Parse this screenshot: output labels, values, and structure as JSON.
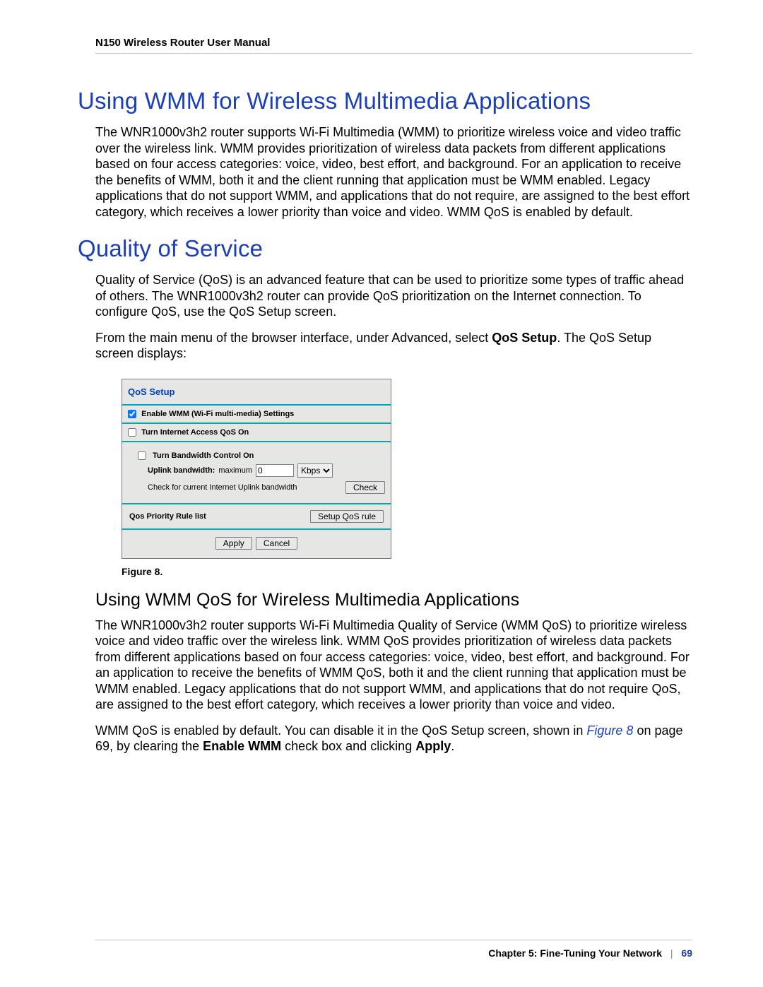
{
  "doc_header": "N150 Wireless Router User Manual",
  "section_wmm_title": "Using WMM for Wireless Multimedia Applications",
  "section_wmm_body": "The WNR1000v3h2 router supports Wi-Fi Multimedia (WMM) to prioritize wireless voice and video traffic over the wireless link. WMM provides prioritization of wireless data packets from different applications based on four access categories: voice, video, best effort, and background. For an application to receive the benefits of WMM, both it and the client running that application must be WMM enabled. Legacy applications that do not support WMM, and applications that do not require, are assigned to the best effort category, which receives a lower priority than voice and video. WMM QoS is enabled by default.",
  "section_qos_title": "Quality of Service",
  "section_qos_body1": "Quality of Service (QoS) is an advanced feature that can be used to prioritize some types of traffic ahead of others. The WNR1000v3h2 router can provide QoS prioritization on the Internet connection. To configure QoS, use the QoS Setup screen.",
  "section_qos_body2_pre": "From the main menu of the browser interface, under Advanced, select ",
  "section_qos_body2_bold": "QoS Setup",
  "section_qos_body2_post": ". The QoS Setup screen displays:",
  "qos_panel": {
    "title": "QoS Setup",
    "enable_wmm_label": "Enable WMM (Wi-Fi multi-media) Settings",
    "enable_wmm_checked": true,
    "internet_qos_label": "Turn Internet Access QoS On",
    "internet_qos_checked": false,
    "bandwidth_ctrl_label": "Turn Bandwidth Control On",
    "bandwidth_ctrl_checked": false,
    "uplink_label_pre": "Uplink bandwidth:",
    "uplink_label_mid": "maximum",
    "uplink_value": "0",
    "uplink_unit": "Kbps",
    "check_label": "Check for current Internet Uplink bandwidth",
    "check_button": "Check",
    "rulelist_label": "Qos Priority Rule list",
    "setup_rule_button": "Setup QoS rule",
    "apply_button": "Apply",
    "cancel_button": "Cancel"
  },
  "figure_caption": "Figure 8. ",
  "subsection_title": "Using WMM QoS for Wireless Multimedia Applications",
  "subsection_body1": "The WNR1000v3h2 router supports Wi-Fi Multimedia Quality of Service (WMM QoS) to prioritize wireless voice and video traffic over the wireless link. WMM QoS provides prioritization of wireless data packets from different applications based on four access categories: voice, video, best effort, and background. For an application to receive the benefits of WMM QoS, both it and the client running that application must be WMM enabled. Legacy applications that do not support WMM, and applications that do not require QoS, are assigned to the best effort category, which receives a lower priority than voice and video.",
  "subsection_body2_a": "WMM QoS is enabled by default. You can disable it in the QoS Setup screen, shown in ",
  "subsection_body2_link": "Figure 8",
  "subsection_body2_b": " on page 69, by clearing the ",
  "subsection_body2_bold1": "Enable WMM",
  "subsection_body2_c": " check box and clicking ",
  "subsection_body2_bold2": "Apply",
  "subsection_body2_d": ".",
  "footer_chapter": "Chapter 5:  Fine-Tuning Your Network",
  "footer_sep": "|",
  "footer_page": "69"
}
